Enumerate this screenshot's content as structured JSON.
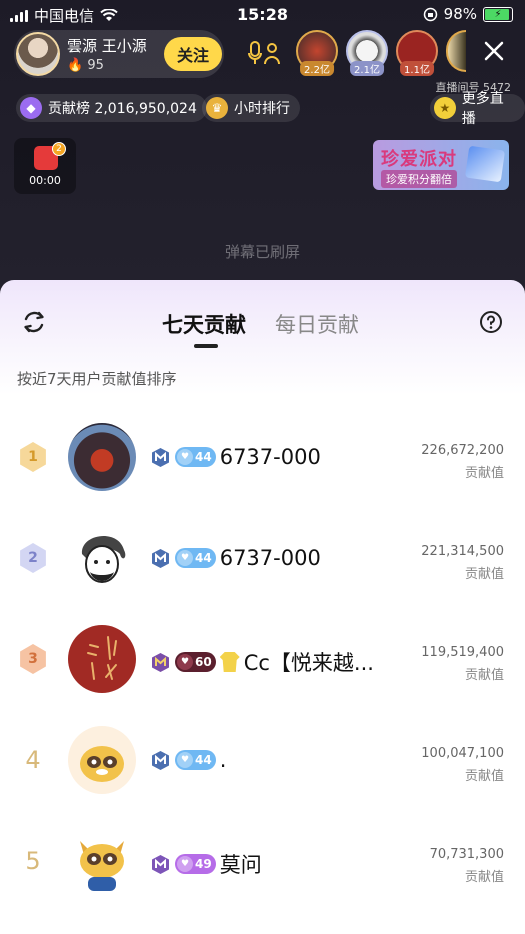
{
  "status_bar": {
    "carrier": "中国电信",
    "time": "15:28",
    "battery": "98%"
  },
  "host": {
    "name": "雲源 王小源",
    "fans": "95",
    "follow_label": "关注"
  },
  "viewers": [
    {
      "count": "2.2亿"
    },
    {
      "count": "2.1亿"
    },
    {
      "count": "1.1亿"
    }
  ],
  "room_id": "直播间号 5472",
  "chips": {
    "contribution": "贡献榜 2,016,950,024",
    "hourly_rank": "小时排行",
    "more_live": "更多直播"
  },
  "redpacket": {
    "badge": "2",
    "timer": "00:00"
  },
  "promo": {
    "title": "珍爱派对",
    "subtitle": "珍爱积分翻倍"
  },
  "danmaku_note": "弹幕已刷屏",
  "sheet": {
    "tabs": [
      {
        "label": "七天贡献",
        "active": true
      },
      {
        "label": "每日贡献",
        "active": false
      }
    ],
    "sort_note": "按近7天用户贡献值排序",
    "score_label": "贡献值",
    "rows": [
      {
        "rank": "1",
        "level": "44",
        "name": "6737-000",
        "score": "226,672,200"
      },
      {
        "rank": "2",
        "level": "44",
        "name": "6737-000",
        "score": "221,314,500"
      },
      {
        "rank": "3",
        "level": "60",
        "name": "Cc【悦来越...",
        "score": "119,519,400"
      },
      {
        "rank": "4",
        "level": "44",
        "name": ".",
        "score": "100,047,100"
      },
      {
        "rank": "5",
        "level": "49",
        "name": "莫问",
        "score": "70,731,300"
      }
    ]
  },
  "colors": {
    "follow": "#ffd84a",
    "gold": "#f2c25a",
    "silver": "#b8bfe9",
    "bronze": "#f0a77c"
  }
}
